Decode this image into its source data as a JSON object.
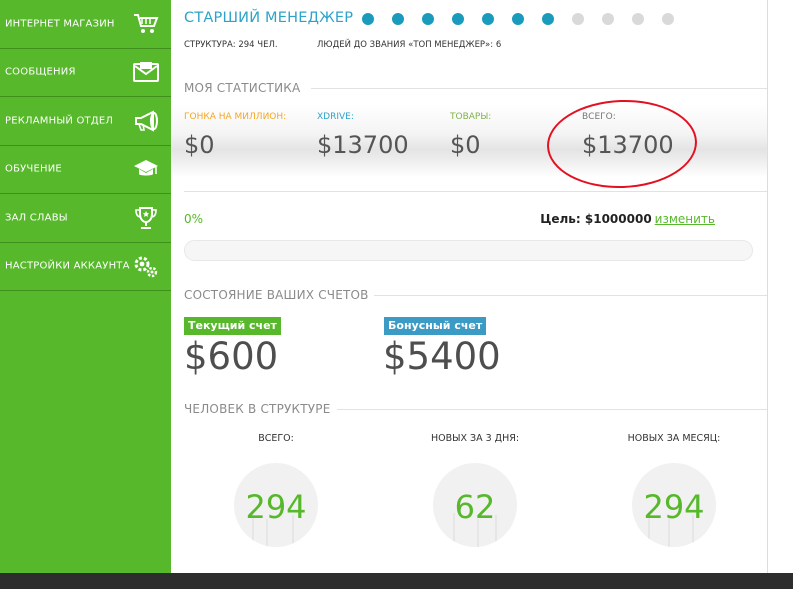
{
  "sidebar": {
    "items": [
      {
        "label": "Интернет магазин",
        "icon": "shopping-cart-icon"
      },
      {
        "label": "Сообщения",
        "icon": "envelope-icon"
      },
      {
        "label": "Рекламный отдел",
        "icon": "megaphone-icon"
      },
      {
        "label": "Обучение",
        "icon": "graduation-cap-icon"
      },
      {
        "label": "Зал славы",
        "icon": "trophy-icon"
      },
      {
        "label": "Настройки аккаунта",
        "icon": "gears-icon"
      }
    ]
  },
  "header": {
    "rank_title": "Старший менеджер",
    "rank_progress": {
      "filled": 7,
      "total": 11
    },
    "structure_text": "Структура: 294 чел.",
    "people_to_rank_text": "Людей до звания «Топ менеджер»: 6"
  },
  "stats": {
    "section_label": "Моя статистика",
    "items": [
      {
        "label": "Гонка на миллион:",
        "value": "$0",
        "color": "#f5a623"
      },
      {
        "label": "XDrive:",
        "value": "$13700",
        "color": "#2ea3c9"
      },
      {
        "label": "Товары:",
        "value": "$0",
        "color": "#7fb24a"
      },
      {
        "label": "Всего:",
        "value": "$13700",
        "color": "#777777"
      }
    ]
  },
  "goal": {
    "percent_text": "0%",
    "progress_fraction": 0,
    "goal_label": "Цель: $1000000",
    "change_link": "изменить"
  },
  "accounts": {
    "section_label": "Состояние ваших счетов",
    "current": {
      "label": "Текущий счет",
      "value": "$600",
      "color": "#57b82b"
    },
    "bonus": {
      "label": "Бонусный счет",
      "value": "$5400",
      "color": "#3b9bc4"
    }
  },
  "people": {
    "section_label": "Человек в структуре",
    "items": [
      {
        "label": "Всего:",
        "value": "294"
      },
      {
        "label": "Новых за 3 дня:",
        "value": "62"
      },
      {
        "label": "Новых за месяц:",
        "value": "294"
      }
    ]
  },
  "colors": {
    "sidebar_green": "#57b82b",
    "accent_blue": "#2ea3c9",
    "highlight_red": "#e3111f"
  }
}
